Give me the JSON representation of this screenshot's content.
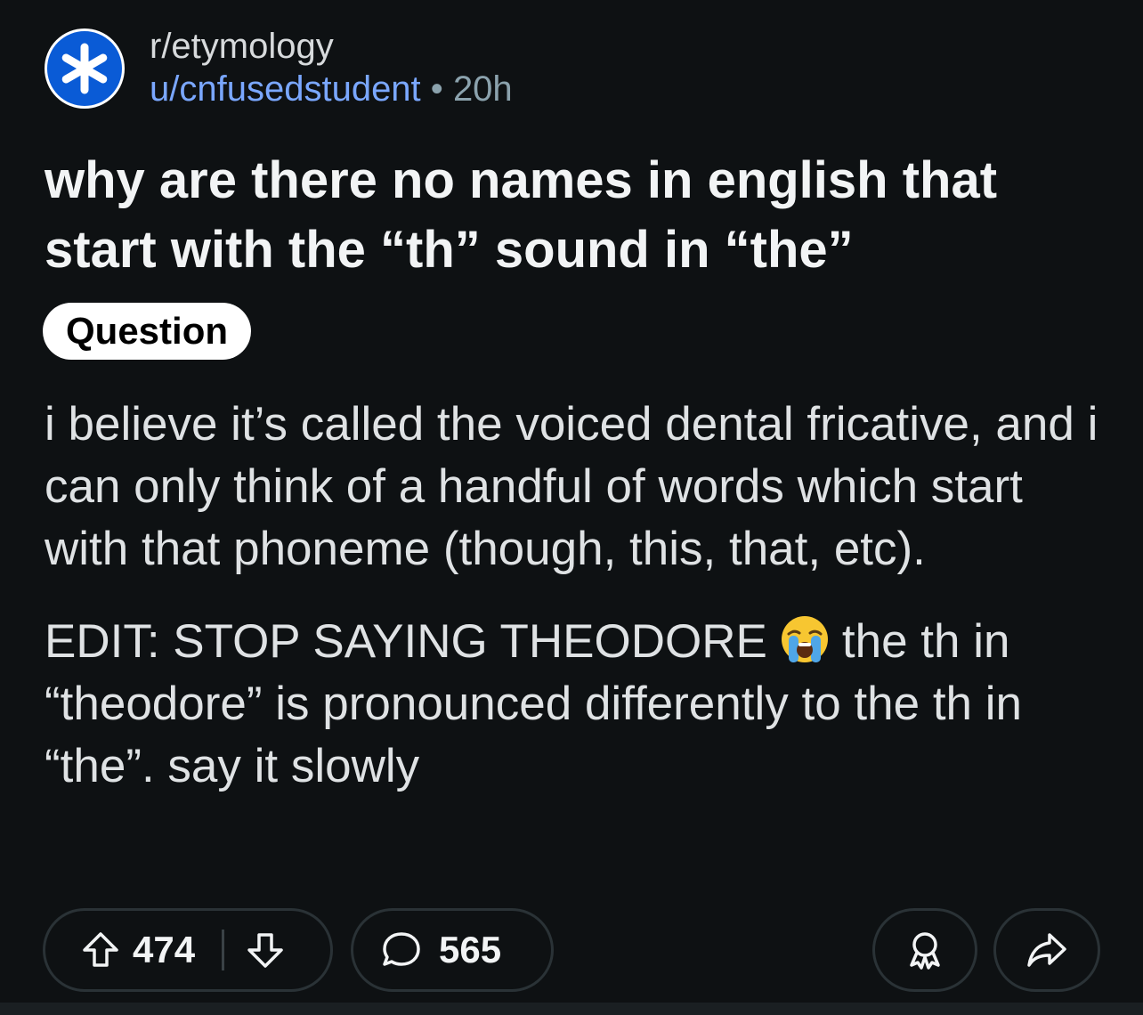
{
  "post": {
    "subreddit": "r/etymology",
    "username": "u/cnfusedstudent",
    "separator": "•",
    "time": "20h",
    "title": "why are there no names in english that start with the “th” sound in “the”",
    "flair": "Question",
    "body_paragraphs": [
      "i believe it’s called the voiced dental fricative, and i can only think of a handful of words which start with that phoneme (though, this, that, etc).",
      "the th in “theodore” is pronounced differently to the th in “the”. say it slowly"
    ],
    "edit_prefix": "EDIT: STOP SAYING THEODORE",
    "edit_emoji": "loudly-crying-face-emoji"
  },
  "actions": {
    "upvotes": "474",
    "comments": "565"
  },
  "colors": {
    "background": "#0e1113",
    "avatar_bg": "#0a5bd6",
    "username": "#7aa7ff",
    "border": "#2a3236"
  },
  "icons": {
    "avatar": "asterisk-icon",
    "upvote": "arrow-up-icon",
    "downvote": "arrow-down-icon",
    "comment": "speech-bubble-icon",
    "save": "award-icon",
    "share": "share-arrow-icon"
  }
}
